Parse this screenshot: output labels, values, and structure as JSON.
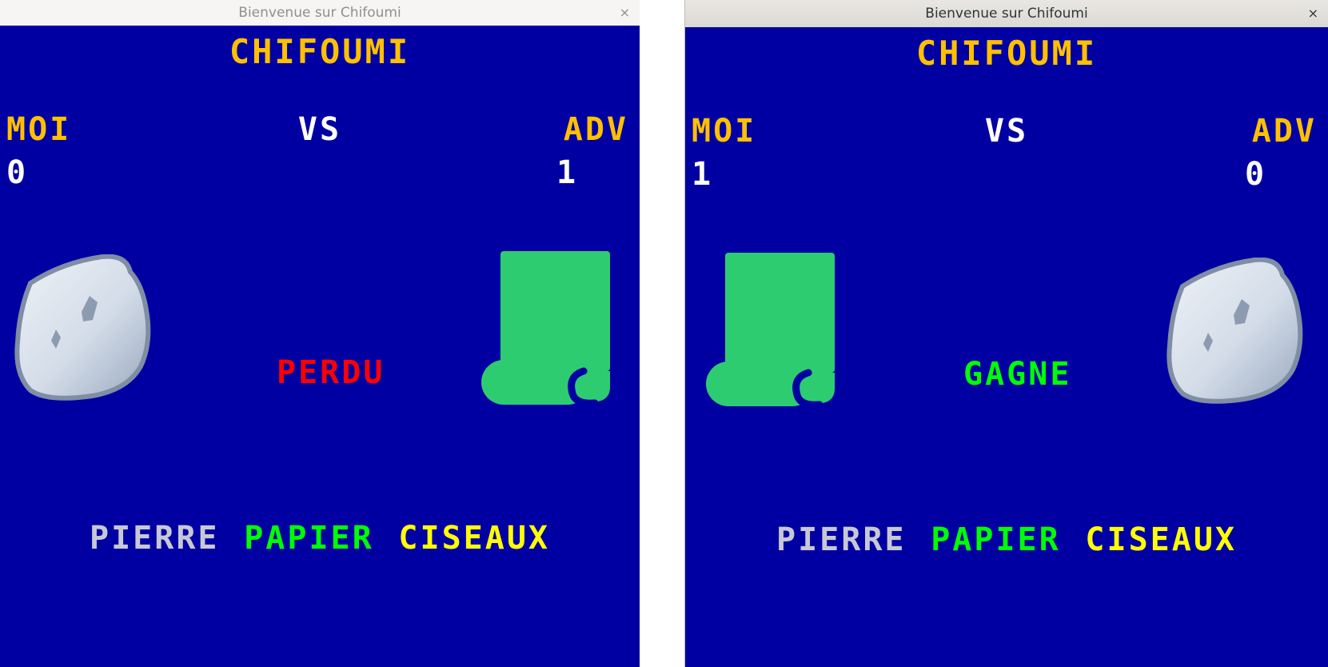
{
  "windows": [
    {
      "title": "Bienvenue sur Chifoumi",
      "close_glyph": "×",
      "game_title": "CHIFOUMI",
      "player_label": "MOI",
      "vs_label": "VS",
      "opponent_label": "ADV",
      "player_score": "0",
      "opponent_score": "1",
      "player_choice_icon": "rock-icon",
      "opponent_choice_icon": "paper-scroll-icon",
      "result": "PERDU",
      "result_color": "#ff0000",
      "choices": [
        "PIERRE",
        "PAPIER",
        "CISEAUX"
      ]
    },
    {
      "title": "Bienvenue sur Chifoumi",
      "close_glyph": "×",
      "game_title": "CHIFOUMI",
      "player_label": "MOI",
      "vs_label": "VS",
      "opponent_label": "ADV",
      "player_score": "1",
      "opponent_score": "0",
      "player_choice_icon": "paper-scroll-icon",
      "opponent_choice_icon": "rock-icon",
      "result": "GAGNE",
      "result_color": "#00ff00",
      "choices": [
        "PIERRE",
        "PAPIER",
        "CISEAUX"
      ]
    }
  ],
  "colors": {
    "background": "#0000a2",
    "title_yellow": "#ffc000",
    "rock_choice": "#c8c8d4",
    "paper_choice": "#00ff00",
    "scissors_choice": "#ffff00",
    "paper_icon": "#2ecc71"
  }
}
